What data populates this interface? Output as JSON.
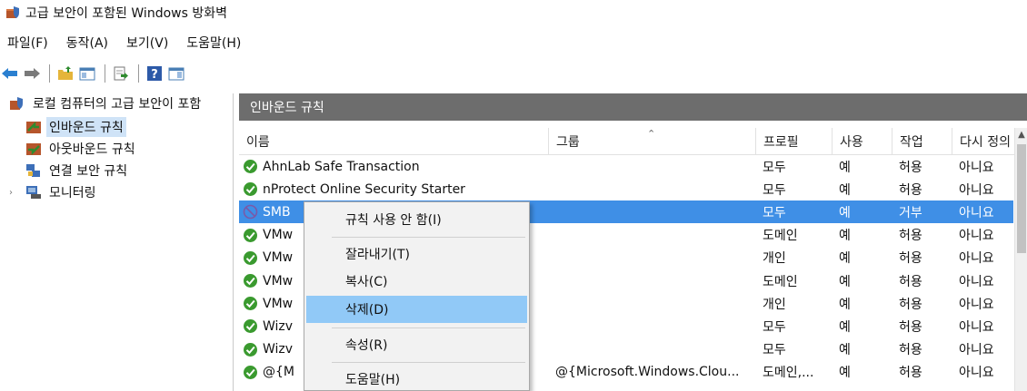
{
  "window": {
    "title": "고급 보안이 포함된 Windows 방화벽"
  },
  "menubar": {
    "items": [
      "파일(F)",
      "동작(A)",
      "보기(V)",
      "도움말(H)"
    ]
  },
  "toolbar": {
    "buttons": [
      "back-arrow-icon",
      "forward-arrow-icon",
      "folder-up-icon",
      "console-tree-icon",
      "export-list-icon",
      "help-icon",
      "action-pane-icon"
    ]
  },
  "tree": {
    "root": "로컬 컴퓨터의 고급 보안이 포함",
    "items": [
      {
        "label": "인바운드 규칙",
        "selected": true
      },
      {
        "label": "아웃바운드 규칙",
        "selected": false
      },
      {
        "label": "연결 보안 규칙",
        "selected": false
      },
      {
        "label": "모니터링",
        "selected": false
      }
    ]
  },
  "pane": {
    "title": "인바운드 규칙",
    "columns": [
      "이름",
      "그룹",
      "프로필",
      "사용",
      "작업",
      "다시 정의"
    ],
    "rows": [
      {
        "name": "AhnLab Safe Transaction",
        "group": "",
        "profile": "모두",
        "enabled": "예",
        "action": "허용",
        "override": "아니요",
        "icon": "allow",
        "selected": false
      },
      {
        "name": "nProtect Online Security Starter",
        "group": "",
        "profile": "모두",
        "enabled": "예",
        "action": "허용",
        "override": "아니요",
        "icon": "allow",
        "selected": false
      },
      {
        "name": "SMB",
        "group": "",
        "profile": "모두",
        "enabled": "예",
        "action": "거부",
        "override": "아니요",
        "icon": "block",
        "selected": true
      },
      {
        "name": "VMw",
        "group": "",
        "profile": "도메인",
        "enabled": "예",
        "action": "허용",
        "override": "아니요",
        "icon": "allow",
        "selected": false
      },
      {
        "name": "VMw",
        "group": "",
        "profile": "개인",
        "enabled": "예",
        "action": "허용",
        "override": "아니요",
        "icon": "allow",
        "selected": false
      },
      {
        "name": "VMw",
        "group": "",
        "profile": "도메인",
        "enabled": "예",
        "action": "허용",
        "override": "아니요",
        "icon": "allow",
        "selected": false
      },
      {
        "name": "VMw",
        "group": "",
        "profile": "개인",
        "enabled": "예",
        "action": "허용",
        "override": "아니요",
        "icon": "allow",
        "selected": false
      },
      {
        "name": "Wizv",
        "group": "",
        "profile": "모두",
        "enabled": "예",
        "action": "허용",
        "override": "아니요",
        "icon": "allow",
        "selected": false
      },
      {
        "name": "Wizv",
        "group": "",
        "profile": "모두",
        "enabled": "예",
        "action": "허용",
        "override": "아니요",
        "icon": "allow",
        "selected": false
      },
      {
        "name": "@{M",
        "group": "@{Microsoft.Windows.Clou...",
        "profile": "도메인,...",
        "enabled": "예",
        "action": "허용",
        "override": "아니요",
        "icon": "allow",
        "selected": false
      }
    ]
  },
  "context_menu": {
    "items": [
      {
        "label": "규칙 사용 안 함(I)",
        "hover": false
      },
      {
        "label": "잘라내기(T)",
        "hover": false
      },
      {
        "label": "복사(C)",
        "hover": false
      },
      {
        "label": "삭제(D)",
        "hover": true
      },
      {
        "label": "속성(R)",
        "hover": false
      },
      {
        "label": "도움말(H)",
        "hover": false
      }
    ]
  },
  "colors": {
    "pane_header_bg": "#6d6d6d",
    "selected_row_bg": "#3f8fe6",
    "menu_hover_bg": "#91c9f7",
    "allow_icon": "#3a9a2f",
    "block_icon": "#7a5aa8"
  }
}
